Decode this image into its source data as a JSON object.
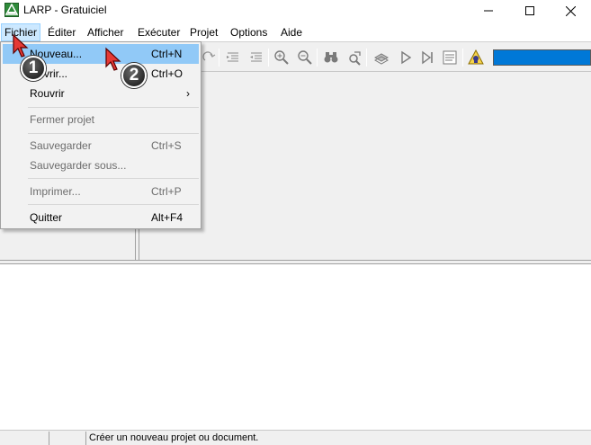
{
  "window": {
    "title": "LARP - Gratuiciel",
    "icon": "larp-app-icon"
  },
  "menubar": {
    "items": [
      {
        "label": "Fichier"
      },
      {
        "label": "Éditer"
      },
      {
        "label": "Afficher"
      },
      {
        "label": "Exécuter"
      },
      {
        "label": "Projet"
      },
      {
        "label": "Options"
      },
      {
        "label": "Aide"
      }
    ]
  },
  "file_menu": {
    "items": [
      {
        "label": "Nouveau...",
        "shortcut": "Ctrl+N",
        "enabled": true,
        "highlighted": true
      },
      {
        "label": "Ouvrir...",
        "shortcut": "Ctrl+O",
        "enabled": true
      },
      {
        "label": "Rouvrir",
        "submenu": true,
        "enabled": true
      },
      {
        "label": "Fermer projet",
        "enabled": false
      },
      {
        "label": "Sauvegarder",
        "shortcut": "Ctrl+S",
        "enabled": false
      },
      {
        "label": "Sauvegarder sous...",
        "enabled": false
      },
      {
        "label": "Imprimer...",
        "shortcut": "Ctrl+P",
        "enabled": false
      },
      {
        "label": "Quitter",
        "shortcut": "Alt+F4",
        "enabled": true
      }
    ],
    "submenu_arrow": "›"
  },
  "annotations": {
    "step1": "1",
    "step2": "2"
  },
  "statusbar": {
    "message": "Créer un nouveau projet ou document."
  },
  "colors": {
    "menu_highlight": "#91c9f7",
    "progress": "#0078d7",
    "badge": "#3a3a3a"
  }
}
